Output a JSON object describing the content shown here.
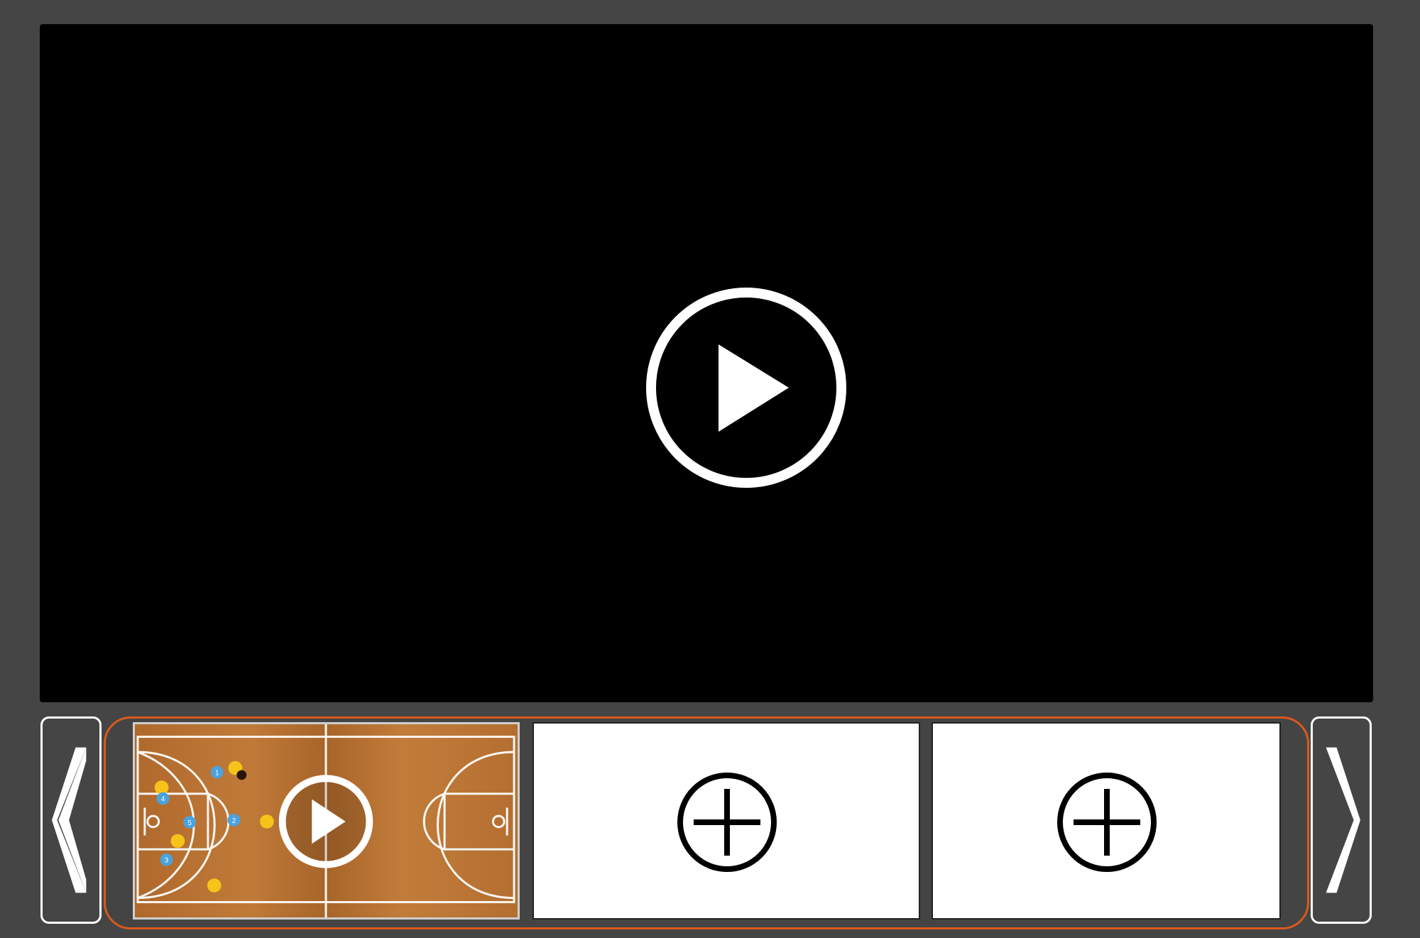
{
  "player": {
    "play_icon": "play-circle-icon"
  },
  "navigation": {
    "previous_icon": "chevron-left-icon",
    "next_icon": "chevron-right-icon"
  },
  "clips": [
    {
      "kind": "thumbnail",
      "content": "basketball-court-diagram",
      "overlay_icon": "play-circle-icon",
      "players": [
        {
          "team": "blue",
          "number": "1"
        },
        {
          "team": "blue",
          "number": "2"
        },
        {
          "team": "blue",
          "number": "3"
        },
        {
          "team": "blue",
          "number": "4"
        },
        {
          "team": "blue",
          "number": "5"
        },
        {
          "team": "yellow"
        },
        {
          "team": "yellow"
        },
        {
          "team": "yellow"
        },
        {
          "team": "yellow"
        },
        {
          "team": "yellow"
        }
      ]
    },
    {
      "kind": "empty",
      "icon": "add-circle-icon"
    },
    {
      "kind": "empty",
      "icon": "add-circle-icon"
    }
  ],
  "colors": {
    "background": "#454545",
    "player_bg": "#000000",
    "strip_border": "#d9591c",
    "court_wood": "#b7702f",
    "team_blue": "#4aa3df",
    "team_yellow": "#f5c31a"
  }
}
